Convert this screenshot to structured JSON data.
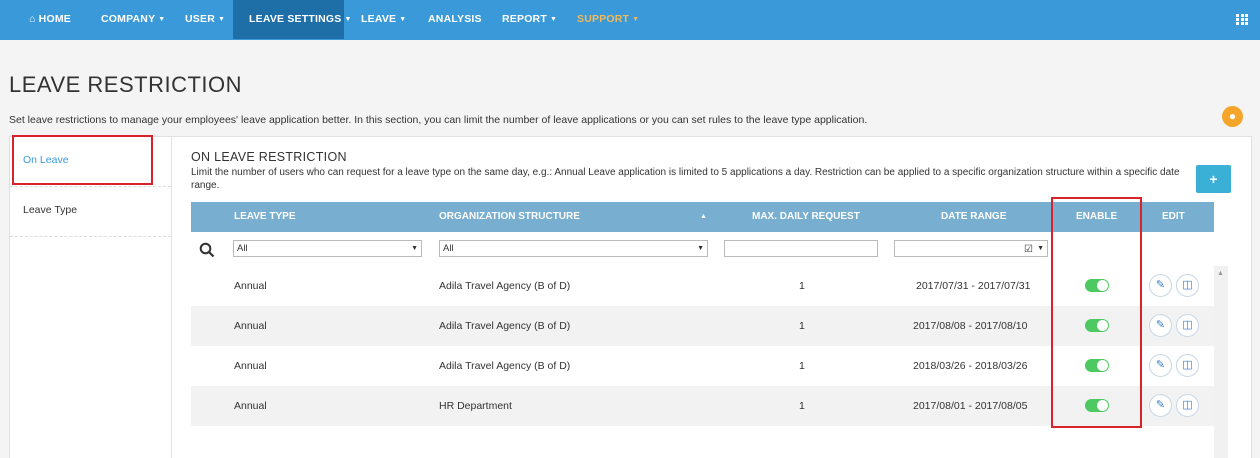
{
  "nav": {
    "items": [
      {
        "label": "HOME",
        "icon": "home-icon",
        "caret": false
      },
      {
        "label": "COMPANY",
        "caret": true
      },
      {
        "label": "USER",
        "caret": true
      },
      {
        "label": "LEAVE SETTINGS",
        "caret": true,
        "active": true
      },
      {
        "label": "LEAVE",
        "caret": true
      },
      {
        "label": "ANALYSIS",
        "caret": false
      },
      {
        "label": "REPORT",
        "caret": true
      },
      {
        "label": "SUPPORT",
        "caret": true
      }
    ],
    "apps_icon": "grid-icon",
    "color": "#3a9ad9"
  },
  "page": {
    "title": "LEAVE RESTRICTION",
    "description": "Set leave restrictions to manage your employees' leave application better. In this section, you can limit the number of leave applications or you can set rules to the leave type application.",
    "help_icon": "lightbulb-icon"
  },
  "sidebar": {
    "items": [
      {
        "label": "On Leave",
        "active": true
      },
      {
        "label": "Leave Type",
        "active": false
      }
    ]
  },
  "section": {
    "title": "ON LEAVE RESTRICTION",
    "description": "Limit the number of users who can request for a leave type on the same day, e.g.: Annual Leave application is limited to 5 applications a day. Restriction can be applied to a specific organization structure within a specific date range.",
    "add_label": "+"
  },
  "table": {
    "columns": [
      "LEAVE TYPE",
      "ORGANIZATION STRUCTURE",
      "MAX. DAILY REQUEST",
      "DATE RANGE",
      "ENABLE",
      "EDIT"
    ],
    "sort_indicator": "▲",
    "filters": {
      "leave_type": "All",
      "organization": "All",
      "max_daily": "",
      "date_range": ""
    },
    "rows": [
      {
        "leave_type": "Annual",
        "organization": "Adila Travel Agency (B of D)",
        "max_daily": "1",
        "date_range": "2017/07/31 - 2017/07/31",
        "enabled": true
      },
      {
        "leave_type": "Annual",
        "organization": "Adila Travel Agency (B of D)",
        "max_daily": "1",
        "date_range": "2017/08/08 - 2017/08/10",
        "enabled": true
      },
      {
        "leave_type": "Annual",
        "organization": "Adila Travel Agency (B of D)",
        "max_daily": "1",
        "date_range": "2018/03/26 - 2018/03/26",
        "enabled": true
      },
      {
        "leave_type": "Annual",
        "organization": "HR Department",
        "max_daily": "1",
        "date_range": "2017/08/01 - 2017/08/05",
        "enabled": true
      }
    ]
  }
}
